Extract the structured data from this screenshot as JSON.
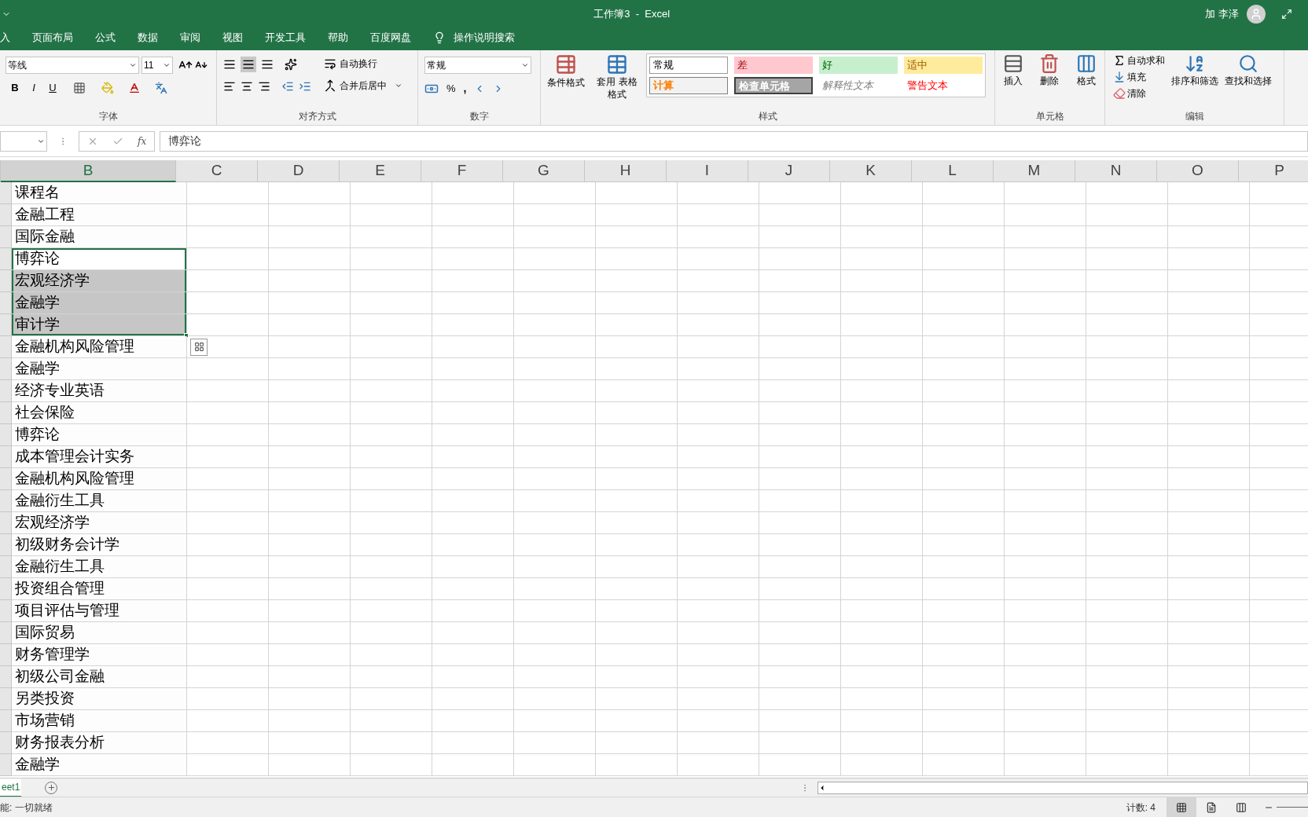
{
  "title_bar": {
    "title": "工作簿3  -  Excel",
    "user": "加 李泽"
  },
  "ribbon_tabs": [
    {
      "label": "入"
    },
    {
      "label": "页面布局"
    },
    {
      "label": "公式"
    },
    {
      "label": "数据"
    },
    {
      "label": "审阅"
    },
    {
      "label": "视图"
    },
    {
      "label": "开发工具"
    },
    {
      "label": "帮助"
    },
    {
      "label": "百度网盘"
    }
  ],
  "tell_me": "操作说明搜索",
  "ribbon": {
    "font_group": {
      "font": "等线",
      "size": "11",
      "format_buttons": [
        "B",
        "I",
        "U"
      ],
      "label": "字体"
    },
    "alignment_group": {
      "wrap": "自动换行",
      "merge": "合并后居中",
      "label": "对齐方式"
    },
    "number_group": {
      "format": "常规",
      "percent": "%",
      "comma": ",",
      "label": "数字"
    },
    "styles_group": {
      "conditional": "条件格式",
      "table": "套用 表格格式",
      "label": "样式",
      "styles": [
        {
          "label": "常规",
          "kind": "normal"
        },
        {
          "label": "差",
          "kind": "bad"
        },
        {
          "label": "好",
          "kind": "good"
        },
        {
          "label": "适中",
          "kind": "neutral"
        },
        {
          "label": "计算",
          "kind": "calc"
        },
        {
          "label": "检查单元格",
          "kind": "check"
        },
        {
          "label": "解释性文本",
          "kind": "explanatory"
        },
        {
          "label": "警告文本",
          "kind": "warning"
        }
      ]
    },
    "cells_group": {
      "insert": "插入",
      "delete": "删除",
      "format": "格式",
      "label": "单元格"
    },
    "editing_group": {
      "autosum": "自动求和",
      "fill": "填充",
      "clear": "清除",
      "sort": "排序和筛选",
      "find": "查找和选择",
      "label": "编辑"
    }
  },
  "formula_bar": {
    "function_label": "fx",
    "value": "博弈论"
  },
  "columns": [
    {
      "label": "B",
      "selected": true
    },
    {
      "label": "C",
      "selected": false
    },
    {
      "label": "D",
      "selected": false
    },
    {
      "label": "E",
      "selected": false
    },
    {
      "label": "F",
      "selected": false
    },
    {
      "label": "G",
      "selected": false
    },
    {
      "label": "H",
      "selected": false
    },
    {
      "label": "I",
      "selected": false
    },
    {
      "label": "J",
      "selected": false
    },
    {
      "label": "K",
      "selected": false
    },
    {
      "label": "L",
      "selected": false
    },
    {
      "label": "M",
      "selected": false
    },
    {
      "label": "N",
      "selected": false
    },
    {
      "label": "O",
      "selected": false
    },
    {
      "label": "P",
      "selected": false
    }
  ],
  "rows": [
    {
      "value": "课程名",
      "selected": false,
      "active": false
    },
    {
      "value": "金融工程",
      "selected": false,
      "active": false
    },
    {
      "value": "国际金融",
      "selected": false,
      "active": false
    },
    {
      "value": "博弈论",
      "selected": true,
      "active": true
    },
    {
      "value": "宏观经济学",
      "selected": true,
      "active": false
    },
    {
      "value": "金融学",
      "selected": true,
      "active": false
    },
    {
      "value": "审计学",
      "selected": true,
      "active": false
    },
    {
      "value": "金融机构风险管理",
      "selected": false,
      "active": false
    },
    {
      "value": "金融学",
      "selected": false,
      "active": false
    },
    {
      "value": "经济专业英语",
      "selected": false,
      "active": false
    },
    {
      "value": "社会保险",
      "selected": false,
      "active": false
    },
    {
      "value": "博弈论",
      "selected": false,
      "active": false
    },
    {
      "value": "成本管理会计实务",
      "selected": false,
      "active": false
    },
    {
      "value": "金融机构风险管理",
      "selected": false,
      "active": false
    },
    {
      "value": "金融衍生工具",
      "selected": false,
      "active": false
    },
    {
      "value": "宏观经济学",
      "selected": false,
      "active": false
    },
    {
      "value": "初级财务会计学",
      "selected": false,
      "active": false
    },
    {
      "value": "金融衍生工具",
      "selected": false,
      "active": false
    },
    {
      "value": "投资组合管理",
      "selected": false,
      "active": false
    },
    {
      "value": "项目评估与管理",
      "selected": false,
      "active": false
    },
    {
      "value": "国际贸易",
      "selected": false,
      "active": false
    },
    {
      "value": "财务管理学",
      "selected": false,
      "active": false
    },
    {
      "value": "初级公司金融",
      "selected": false,
      "active": false
    },
    {
      "value": "另类投资",
      "selected": false,
      "active": false
    },
    {
      "value": "市场营销",
      "selected": false,
      "active": false
    },
    {
      "value": "财务报表分析",
      "selected": false,
      "active": false
    },
    {
      "value": "金融学",
      "selected": false,
      "active": false
    }
  ],
  "sheet_tabs": [
    {
      "label": "eet1",
      "selected": true
    }
  ],
  "status_bar": {
    "ready": "能: 一切就绪",
    "count": "计数: 4"
  }
}
